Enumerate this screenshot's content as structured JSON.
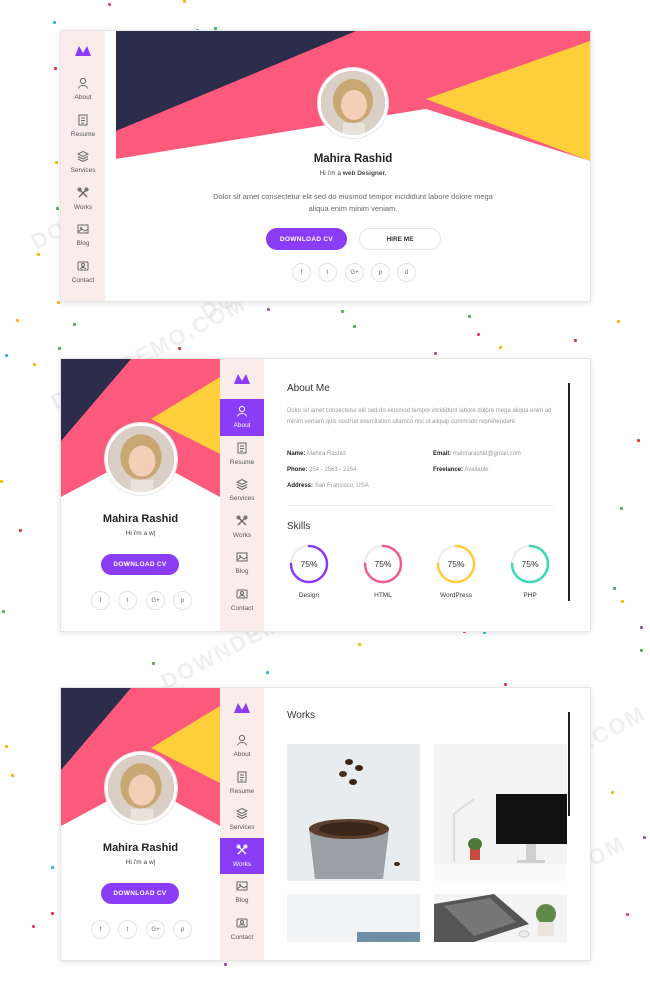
{
  "profile": {
    "name": "Mahira Rashid",
    "tagline_prefix": "Hi i'm a ",
    "tagline_role": "web Designer.",
    "tagline_short": "Hi i'm a w|",
    "intro": "Dolor sit amet consectetur elit sed do eiusmod tempor incididunt labore dolore mega aliqua enim minim veniam.",
    "download_cv": "DOWNLOAD CV",
    "hire_me": "HIRE ME",
    "social": [
      "f",
      "t",
      "G+",
      "p",
      "d"
    ]
  },
  "nav": {
    "items": [
      {
        "label": "About",
        "icon": "user-icon"
      },
      {
        "label": "Resume",
        "icon": "document-icon"
      },
      {
        "label": "Services",
        "icon": "layers-icon"
      },
      {
        "label": "Works",
        "icon": "tools-icon"
      },
      {
        "label": "Blog",
        "icon": "image-icon"
      },
      {
        "label": "Contact",
        "icon": "contact-icon"
      }
    ]
  },
  "about": {
    "title": "About Me",
    "text": "Dolor sit amet consectetur elit sed do eiusmod tempor incididunt labore dolore mega aliqua enim ad minim veniam quis nostrud exercitation ullamco nisi ut aliquip commodo reprehenderit.",
    "name_label": "Name:",
    "name_value": "Mahira Rashid",
    "email_label": "Email:",
    "email_value": "mahirarashid@gmail.com",
    "phone_label": "Phone:",
    "phone_value": "254 - 2563 - 2154",
    "freelance_label": "Freelance:",
    "freelance_value": "Available",
    "address_label": "Address:",
    "address_value": "San Francisco, USA"
  },
  "skills": {
    "title": "Skills",
    "items": [
      {
        "label": "Design",
        "value": "75%",
        "fraction": 0.75,
        "color": "#8b3cf6"
      },
      {
        "label": "HTML",
        "value": "75%",
        "fraction": 0.75,
        "color": "#f25c8a"
      },
      {
        "label": "WordPress",
        "value": "75%",
        "fraction": 0.75,
        "color": "#ffcd3c"
      },
      {
        "label": "PHP",
        "value": "75%",
        "fraction": 0.75,
        "color": "#3ed6b8"
      }
    ]
  },
  "works": {
    "title": "Works"
  },
  "watermark": "DOWNDEMO.COM",
  "colors": {
    "navy": "#2b2d4a",
    "pink": "#fc5a7d",
    "yellow": "#ffcf3b",
    "purple": "#8b3cf6"
  }
}
